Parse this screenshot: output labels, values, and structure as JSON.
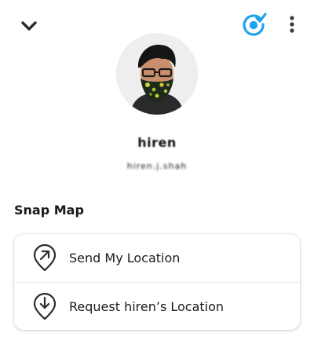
{
  "header": {
    "back_icon": "chevron-down-icon",
    "bitmoji_icon": "bitmoji-check-icon",
    "more_icon": "more-vertical-icon"
  },
  "profile": {
    "display_name": "hiren",
    "username": "hiren.j.shah",
    "avatar": "bitmoji-avatar"
  },
  "snap_map": {
    "title": "Snap Map",
    "actions": [
      {
        "label": "Send My Location",
        "icon": "location-arrow-pin-icon"
      },
      {
        "label": "Request hiren’s Location",
        "icon": "location-download-pin-icon"
      }
    ]
  },
  "colors": {
    "accent": "#1fa3ec",
    "text": "#1b1b1b",
    "divider": "#e8e8e8"
  }
}
